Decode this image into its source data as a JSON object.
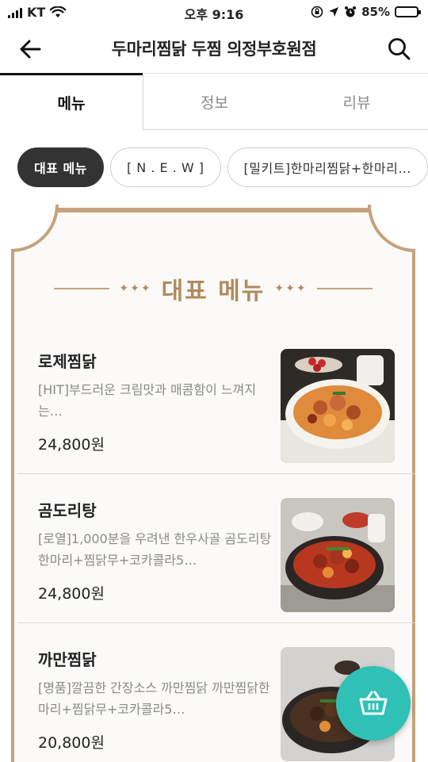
{
  "status_bar": {
    "carrier": "KT",
    "time": "오후 9:16",
    "battery_text": "85%",
    "battery_level": 0.85
  },
  "header": {
    "title": "두마리찜닭 두찜 의정부호원점"
  },
  "tabs": [
    {
      "label": "메뉴",
      "active": true
    },
    {
      "label": "정보",
      "active": false
    },
    {
      "label": "리뷰",
      "active": false
    }
  ],
  "chips": [
    {
      "label": "대표 메뉴",
      "active": true
    },
    {
      "label": "[ N . E . W ]",
      "active": false
    },
    {
      "label": "[밀키트]한마리찜닭+한마리…",
      "active": false
    }
  ],
  "section": {
    "heading": "대표 메뉴",
    "accent_color": "#c6a27b"
  },
  "menu_items": [
    {
      "name": "로제찜닭",
      "description": "[HIT]부드러운 크림맛과 매콤함이 느껴지는…",
      "price": "24,800원"
    },
    {
      "name": "곰도리탕",
      "description": "[로열]1,000분을 우려낸 한우사골 곰도리탕한마리+찜닭무+코카콜라5…",
      "price": "24,800원"
    },
    {
      "name": "까만찜닭",
      "description": "[명품]깔끔한 간장소스 까만찜닭 까만찜닭한마리+찜닭무+코카콜라5…",
      "price": "20,800원"
    }
  ],
  "cart": {
    "icon": "basket-icon",
    "color": "#2fc0b6"
  }
}
